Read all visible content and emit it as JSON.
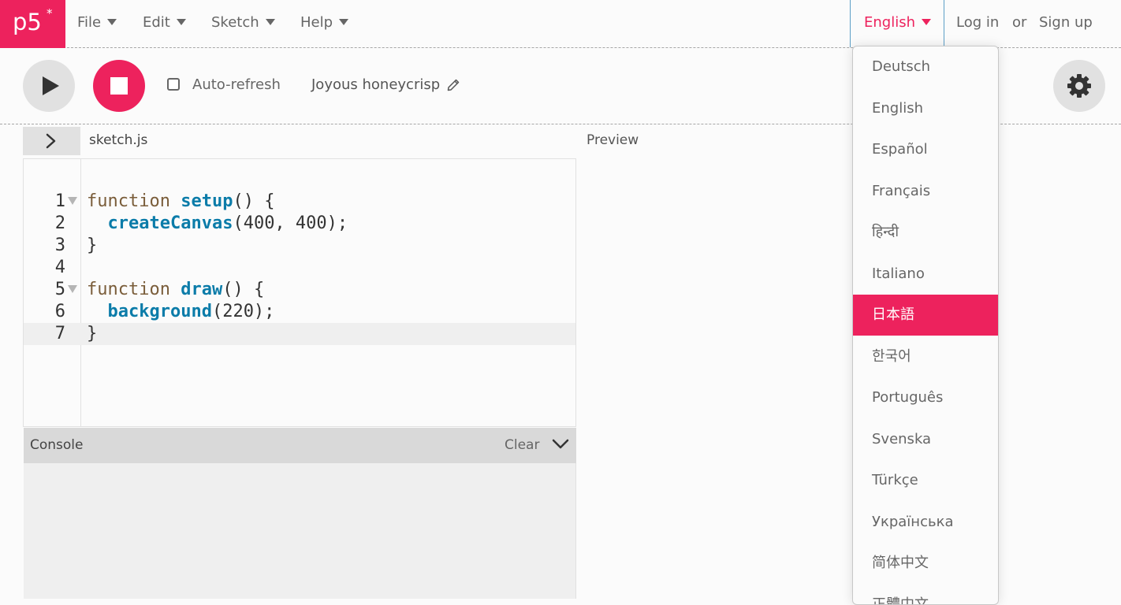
{
  "nav": {
    "logo_text": "p5",
    "logo_star": "*",
    "menus": [
      "File",
      "Edit",
      "Sketch",
      "Help"
    ],
    "language": "English",
    "login": "Log in",
    "or": "or",
    "signup": "Sign up"
  },
  "toolbar": {
    "auto_refresh_label": "Auto-refresh",
    "auto_refresh_checked": false,
    "sketch_name": "Joyous honeycrisp"
  },
  "editor": {
    "file_name": "sketch.js",
    "preview_label": "Preview",
    "active_line": 7,
    "lines": [
      {
        "n": "1",
        "fold": true,
        "kw": "function ",
        "fn": "setup",
        "rest": "() {"
      },
      {
        "n": "2",
        "fold": false,
        "kw": "  ",
        "fn": "createCanvas",
        "rest": "(400, 400);"
      },
      {
        "n": "3",
        "fold": false,
        "kw": "",
        "fn": "",
        "rest": "}"
      },
      {
        "n": "4",
        "fold": false,
        "kw": "",
        "fn": "",
        "rest": ""
      },
      {
        "n": "5",
        "fold": true,
        "kw": "function ",
        "fn": "draw",
        "rest": "() {"
      },
      {
        "n": "6",
        "fold": false,
        "kw": "  ",
        "fn": "background",
        "rest": "(220);"
      },
      {
        "n": "7",
        "fold": false,
        "kw": "",
        "fn": "",
        "rest": "}"
      }
    ]
  },
  "console": {
    "title": "Console",
    "clear": "Clear"
  },
  "language_menu": {
    "selected": "日本語",
    "items": [
      "Deutsch",
      "English",
      "Español",
      "Français",
      "हिन्दी",
      "Italiano",
      "日本語",
      "한국어",
      "Português",
      "Svenska",
      "Türkçe",
      "Українська",
      "简体中文",
      "正體中文"
    ]
  },
  "colors": {
    "accent": "#ed225d",
    "focus_border": "#5c9fc7"
  },
  "icons": {
    "play": "play-icon",
    "stop": "stop-icon",
    "pencil": "pencil-icon",
    "settings": "gear-icon",
    "expand": "chevron-right-icon",
    "collapse": "chevron-down-icon"
  }
}
